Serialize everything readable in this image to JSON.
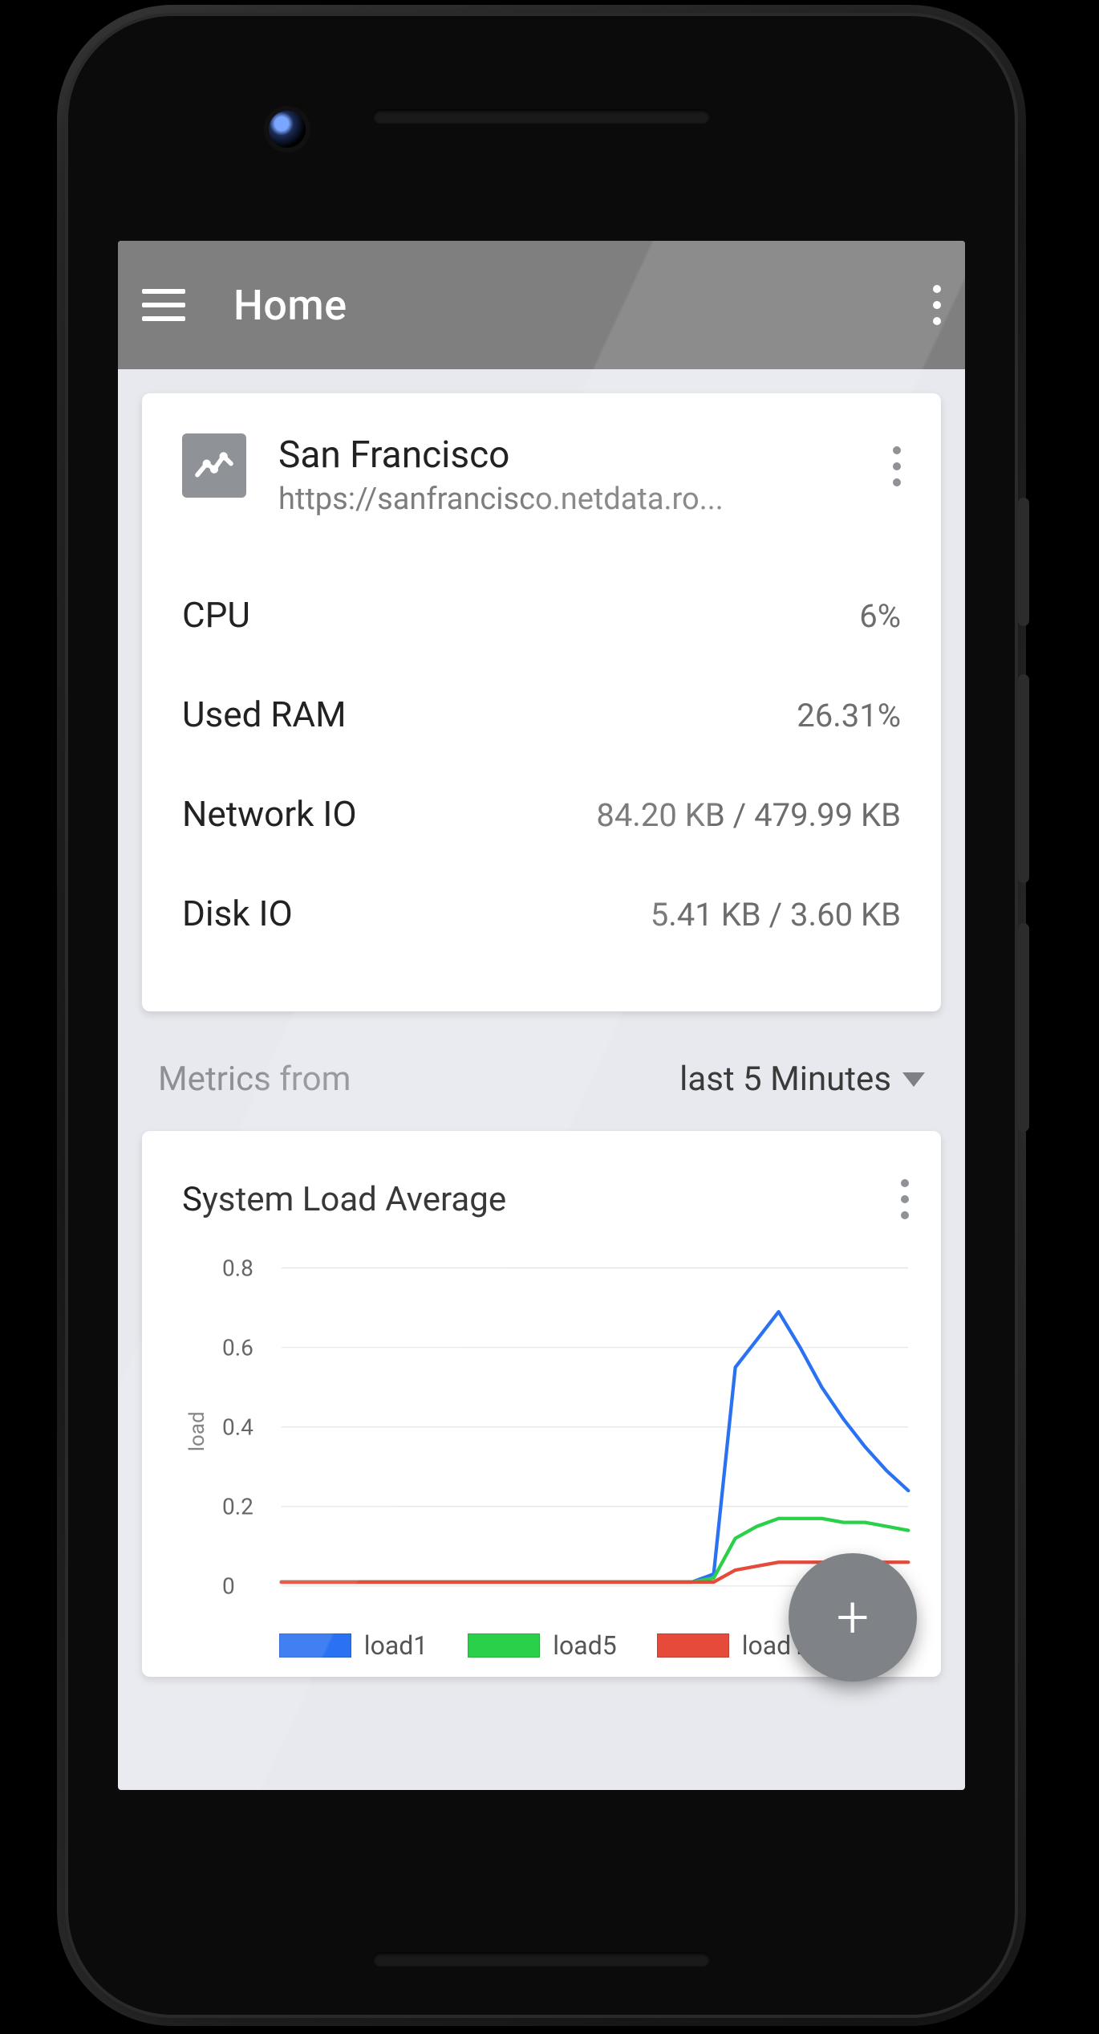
{
  "appbar": {
    "title": "Home"
  },
  "server": {
    "name": "San Francisco",
    "url": "https://sanfrancisco.netdata.ro...",
    "metrics": [
      {
        "label": "CPU",
        "value": "6%"
      },
      {
        "label": "Used RAM",
        "value": "26.31%"
      },
      {
        "label": "Network IO",
        "value": "84.20 KB / 479.99 KB"
      },
      {
        "label": "Disk IO",
        "value": "5.41 KB / 3.60 KB"
      }
    ]
  },
  "range": {
    "label": "Metrics from",
    "selected": "last 5 Minutes"
  },
  "chart": {
    "title": "System Load Average",
    "ylabel": "load",
    "yticks": [
      "0",
      "0.2",
      "0.4",
      "0.6",
      "0.8"
    ],
    "legend": [
      {
        "name": "load1",
        "color": "#2b72f2"
      },
      {
        "name": "load5",
        "color": "#2bd04a"
      },
      {
        "name": "load15",
        "color": "#e64a3b"
      }
    ]
  },
  "fab": {
    "label": "+"
  },
  "chart_data": {
    "type": "line",
    "title": "System Load Average",
    "xlabel": "",
    "ylabel": "load",
    "ylim": [
      0,
      0.8
    ],
    "x": [
      0,
      1,
      2,
      3,
      4,
      5,
      6,
      7,
      8,
      9,
      10,
      11,
      12,
      13,
      14,
      15,
      16,
      17,
      18,
      19,
      20,
      21,
      22,
      23,
      24,
      25,
      26,
      27,
      28,
      29
    ],
    "series": [
      {
        "name": "load1",
        "color": "#2b72f2",
        "values": [
          0.01,
          0.01,
          0.01,
          0.01,
          0.01,
          0.01,
          0.01,
          0.01,
          0.01,
          0.01,
          0.01,
          0.01,
          0.01,
          0.01,
          0.01,
          0.01,
          0.01,
          0.01,
          0.01,
          0.01,
          0.03,
          0.55,
          0.62,
          0.69,
          0.6,
          0.5,
          0.42,
          0.35,
          0.29,
          0.24
        ]
      },
      {
        "name": "load5",
        "color": "#2bd04a",
        "values": [
          0.01,
          0.01,
          0.01,
          0.01,
          0.01,
          0.01,
          0.01,
          0.01,
          0.01,
          0.01,
          0.01,
          0.01,
          0.01,
          0.01,
          0.01,
          0.01,
          0.01,
          0.01,
          0.01,
          0.01,
          0.02,
          0.12,
          0.15,
          0.17,
          0.17,
          0.17,
          0.16,
          0.16,
          0.15,
          0.14
        ]
      },
      {
        "name": "load15",
        "color": "#e64a3b",
        "values": [
          0.01,
          0.01,
          0.01,
          0.01,
          0.01,
          0.01,
          0.01,
          0.01,
          0.01,
          0.01,
          0.01,
          0.01,
          0.01,
          0.01,
          0.01,
          0.01,
          0.01,
          0.01,
          0.01,
          0.01,
          0.01,
          0.04,
          0.05,
          0.06,
          0.06,
          0.06,
          0.06,
          0.06,
          0.06,
          0.06
        ]
      }
    ]
  }
}
